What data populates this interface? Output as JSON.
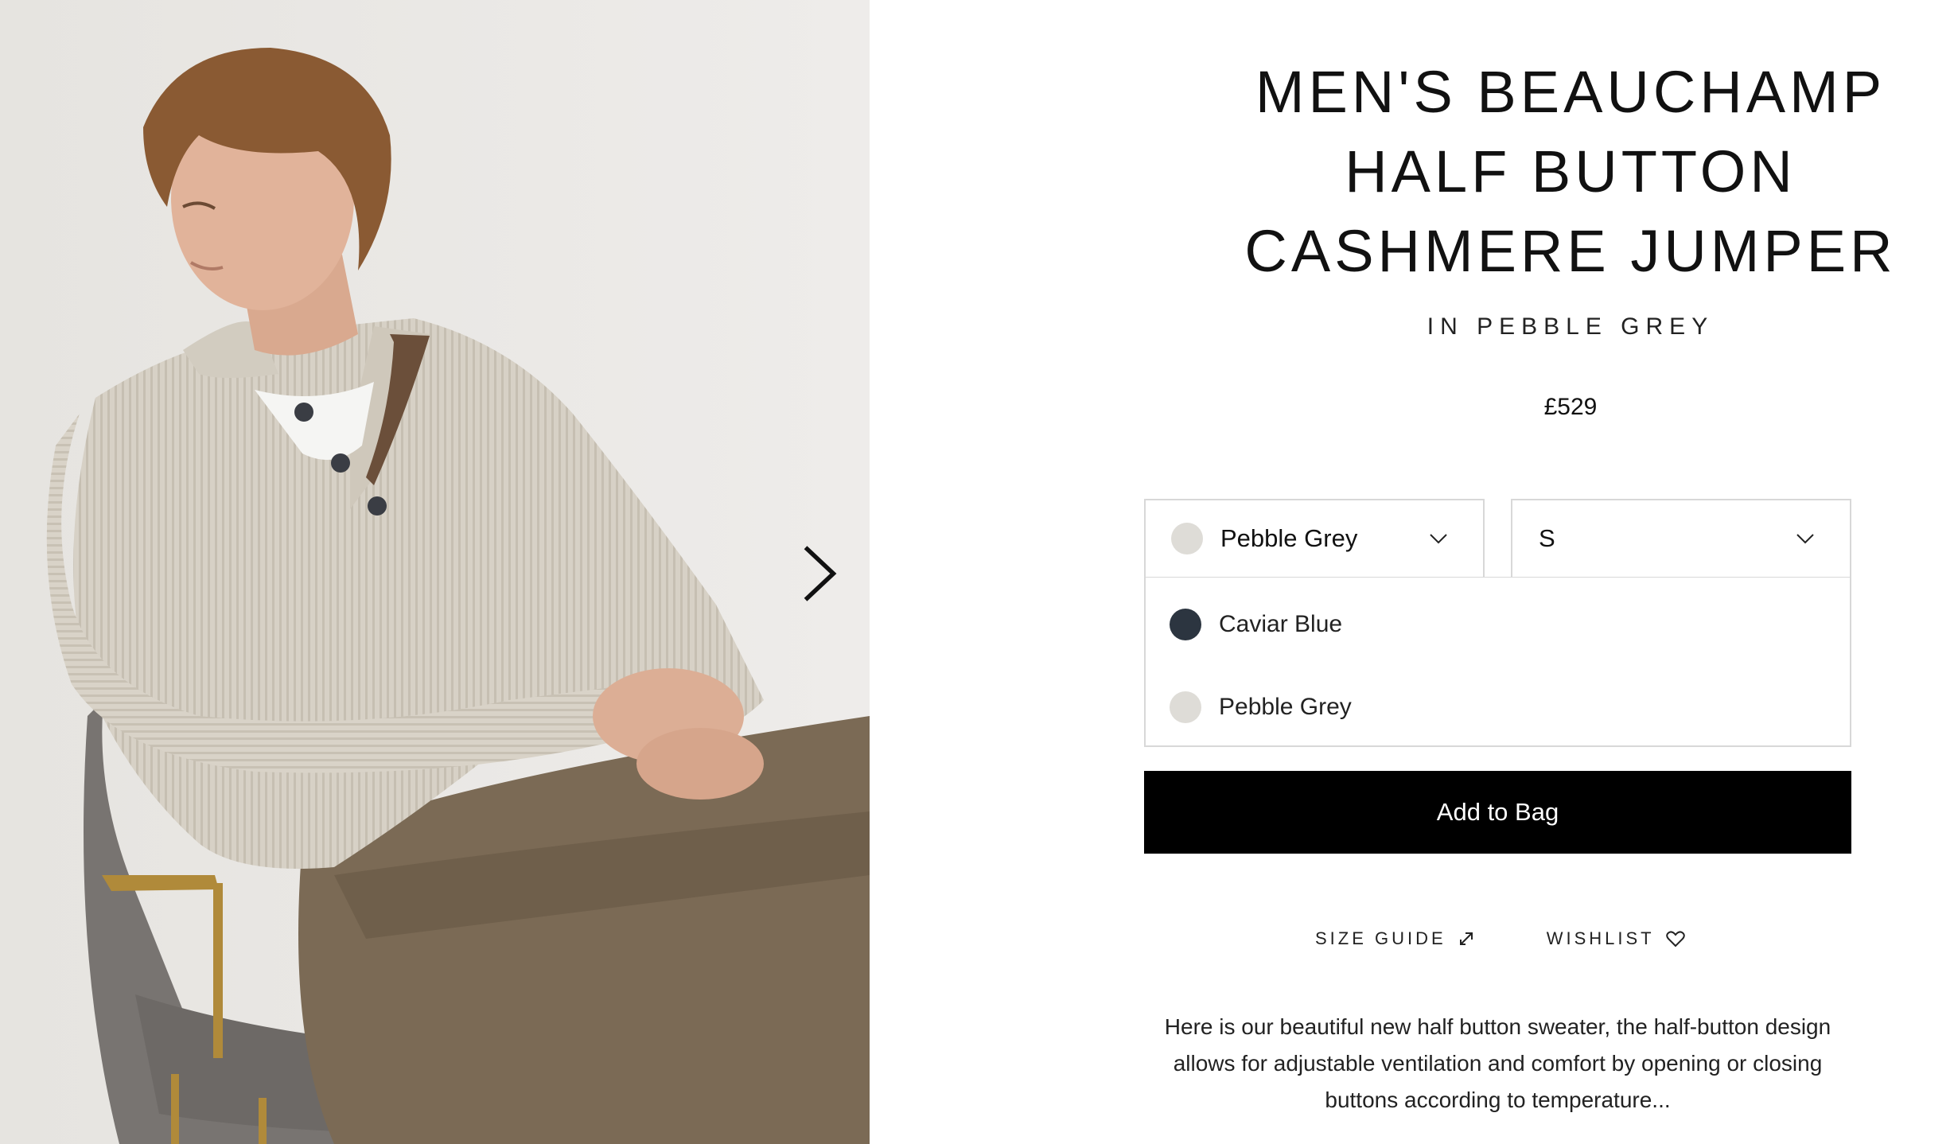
{
  "gallery": {
    "image_alt": "",
    "next_icon": "chevron-right-icon"
  },
  "product": {
    "title_lines": [
      "MEN'S BEAUCHAMP",
      "HALF BUTTON",
      "CASHMERE JUMPER"
    ],
    "subtitle": "IN PEBBLE GREY",
    "price": "£529",
    "description": "Here is our beautiful new half button sweater, the half-button design allows for adjustable ventilation and comfort by opening or closing buttons according to temperature..."
  },
  "colour_select": {
    "value": "Pebble Grey",
    "swatch_color": "#dedcd7",
    "icon": "chevron-down-icon",
    "options": [
      {
        "label": "Caviar Blue",
        "swatch_color": "#2c3540"
      },
      {
        "label": "Pebble Grey",
        "swatch_color": "#dedcd7"
      }
    ]
  },
  "size_select": {
    "value": "S",
    "icon": "chevron-down-icon"
  },
  "actions": {
    "add_to_bag": "Add to Bag",
    "size_guide": "SIZE GUIDE",
    "size_guide_icon": "external-link-icon",
    "wishlist": "WISHLIST",
    "wishlist_icon": "heart-icon"
  },
  "colors": {
    "button_bg": "#000000",
    "border": "#d8d8d8"
  }
}
